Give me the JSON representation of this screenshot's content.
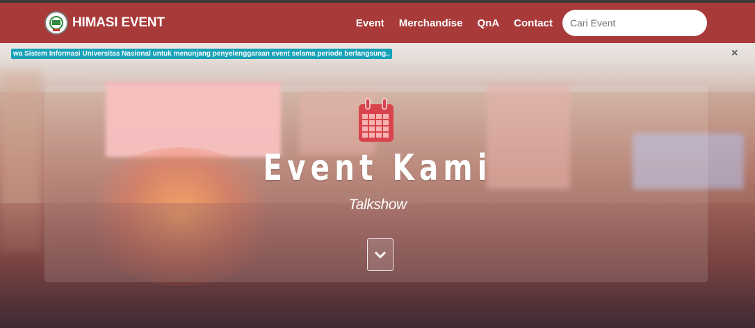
{
  "navbar": {
    "brand": "HIMASI EVENT",
    "links": [
      "Event",
      "Merchandise",
      "QnA",
      "Contact"
    ],
    "search_placeholder": "Cari Event"
  },
  "ticker": {
    "text": "wa Sistem Informasi Universitas Nasional untuk menunjang penyelenggaraan event selama periode berlangsung..",
    "close_glyph": "×"
  },
  "hero": {
    "title": "Event Kami",
    "subtitle": "Talkshow",
    "icon": "calendar-icon",
    "scroll_icon": "chevron-down-icon"
  },
  "colors": {
    "navbar": "#a93a3a",
    "accent_icon": "#d9444c",
    "ticker_bg": "#17a2b8"
  }
}
